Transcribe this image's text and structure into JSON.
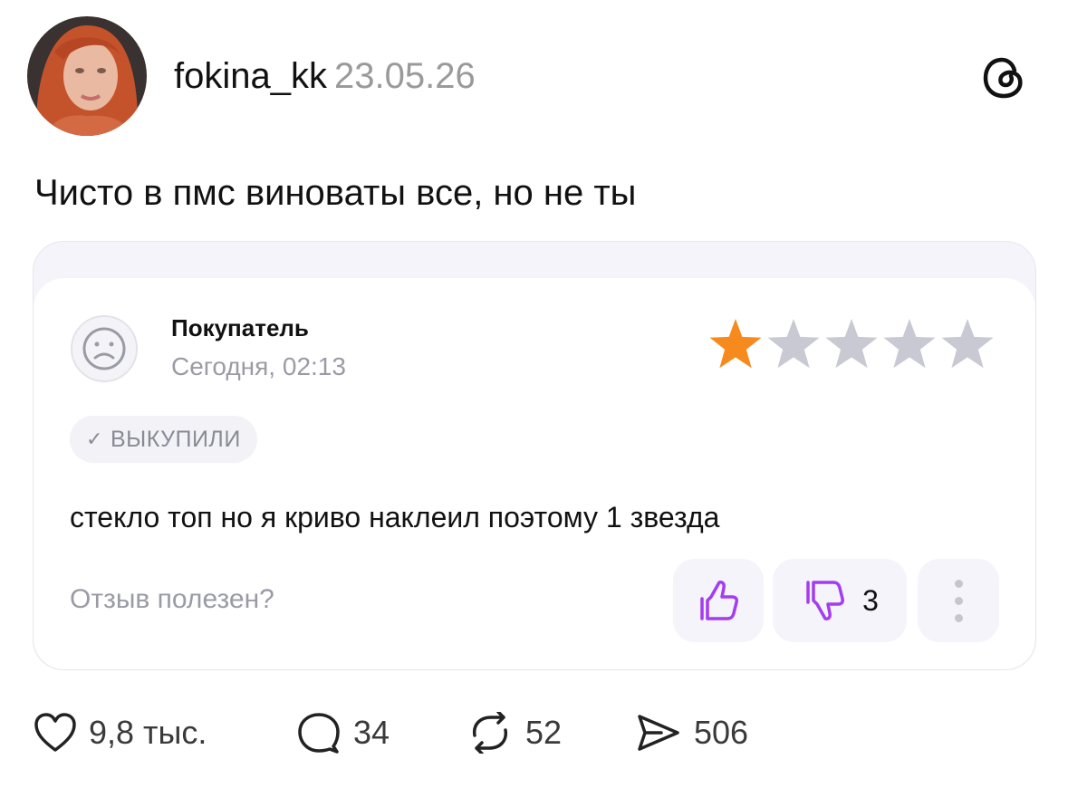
{
  "post": {
    "username": "fokina_kk",
    "date": "23.05.26",
    "text": "Чисто в пмс виноваты все, но не ты"
  },
  "review_card": {
    "buyer_name": "Покупатель",
    "buyer_time": "Сегодня, 02:13",
    "rating": 1,
    "rating_max": 5,
    "badge_label": "ВЫКУПИЛИ",
    "review_text": "стекло топ но я криво наклеил поэтому 1 звезда",
    "helpful_prompt": "Отзыв полезен?",
    "dislike_count": "3",
    "colors": {
      "star_active": "#f78a1c",
      "star_inactive": "#c9c9d3",
      "thumb_accent": "#a43cf0"
    }
  },
  "actions": {
    "likes": "9,8 тыс.",
    "comments": "34",
    "reposts": "52",
    "shares": "506"
  },
  "icons": [
    "threads-logo-icon",
    "sad-face-icon",
    "star-icon",
    "check-icon",
    "thumb-up-icon",
    "thumb-down-icon",
    "more-vertical-icon",
    "heart-icon",
    "comment-icon",
    "repost-icon",
    "share-icon"
  ]
}
